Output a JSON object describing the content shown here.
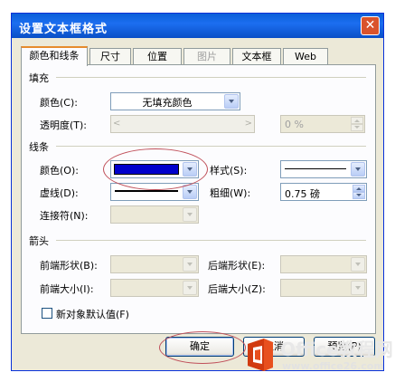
{
  "window": {
    "title": "设置文本框格式",
    "close_glyph": "✕"
  },
  "tabs": [
    {
      "label": "颜色和线条",
      "active": true,
      "disabled": false
    },
    {
      "label": "尺寸",
      "active": false,
      "disabled": false
    },
    {
      "label": "位置",
      "active": false,
      "disabled": false
    },
    {
      "label": "图片",
      "active": false,
      "disabled": true
    },
    {
      "label": "文本框",
      "active": false,
      "disabled": false
    },
    {
      "label": "Web",
      "active": false,
      "disabled": false
    }
  ],
  "fill": {
    "section_label": "填充",
    "color_label": "颜色(C):",
    "color_value": "无填充颜色",
    "transparency_label": "透明度(T):",
    "transparency_value": "0 %",
    "slider_left": "<",
    "slider_right": ">"
  },
  "line": {
    "section_label": "线条",
    "color_label": "颜色(O):",
    "color_swatch": "#0000cc",
    "style_label": "样式(S):",
    "dash_label": "虚线(D):",
    "weight_label": "粗细(W):",
    "weight_value": "0.75 磅",
    "connector_label": "连接符(N):"
  },
  "arrows": {
    "section_label": "箭头",
    "begin_style_label": "前端形状(B):",
    "end_style_label": "后端形状(E):",
    "begin_size_label": "前端大小(I):",
    "end_size_label": "后端大小(Z):"
  },
  "default_checkbox": {
    "label": "新对象默认值(F)",
    "checked": false
  },
  "buttons": {
    "ok": "确定",
    "cancel": "取消",
    "preview": "预览(P)"
  },
  "watermark": {
    "brand_main": "Office教程网",
    "brand_url": "www.office26.com"
  },
  "colors": {
    "title_bar": "#0a5fd8",
    "dialog_bg": "#ece9d8",
    "annotation": "#c0505a",
    "watermark_logo": "#e8501e"
  }
}
